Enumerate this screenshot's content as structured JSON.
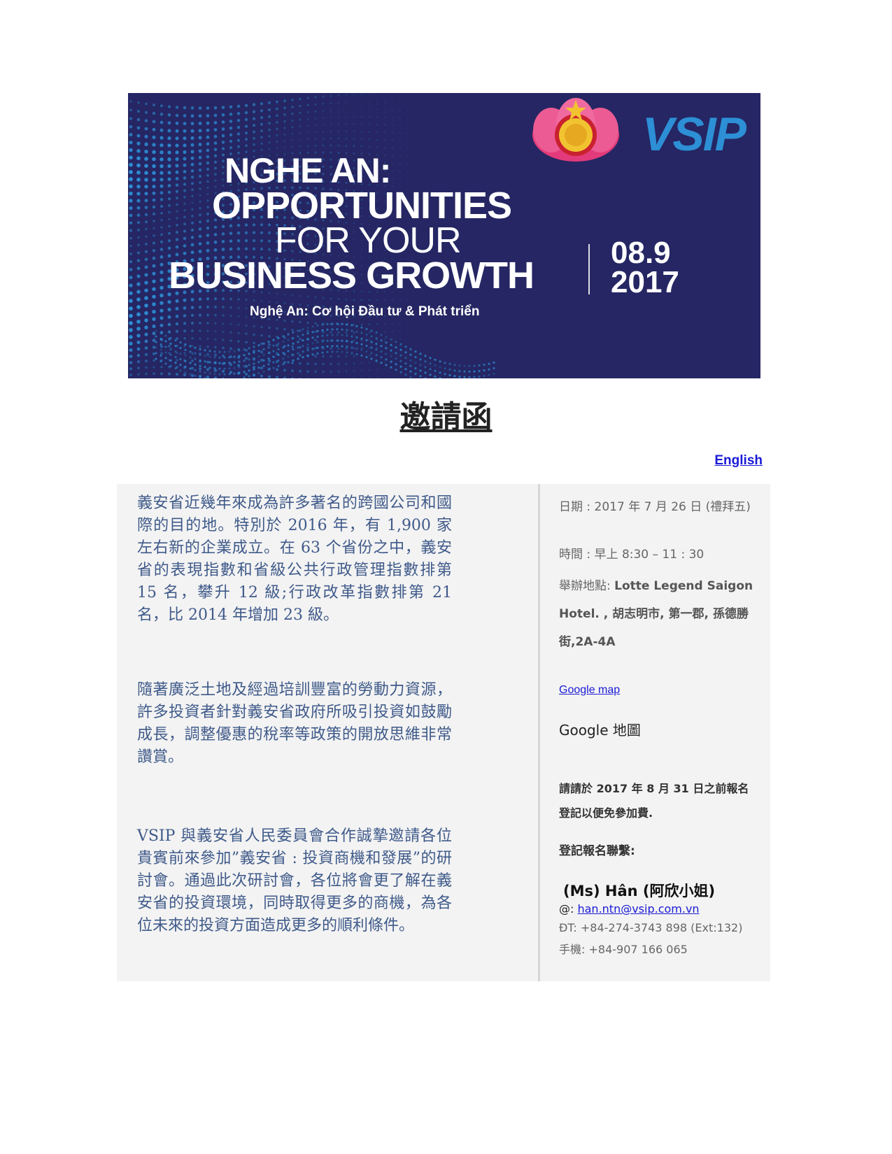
{
  "banner": {
    "title_line1": "NGHE AN:",
    "title_line2": "OPPORTUNITIES",
    "title_line3": "FOR YOUR",
    "title_line4": "BUSINESS GROWTH",
    "subtitle": "Nghệ An: Cơ hội Đầu tư & Phát triển",
    "date_line1": "08.9",
    "date_line2": "2017",
    "logo_text": "VSIP",
    "background_color": "#252663",
    "accent_color": "#2d8fd5"
  },
  "doc": {
    "title": "邀請函",
    "language_link": "English"
  },
  "left": {
    "para1": "義安省近幾年來成為許多著名的跨國公司和國際的目的地。特別於 2016 年，有 1,900 家左右新的企業成立。在 63 个省份之中，義安省的表現指數和省級公共行政管理指數排第 15 名，攀升 12 級;行政改革指數排第 21 名，比 2014 年增加 23 級。",
    "para2": "隨著廣泛土地及經過培訓豐富的勞動力資源，許多投資者針對義安省政府所吸引投資如鼓勵成長，調整優惠的稅率等政策的開放思維非常讚賞。",
    "para3": "VSIP 與義安省人民委員會合作誠摯邀請各位貴賓前來參加”義安省 : 投資商機和發展”的研討會。通過此次研討會，各位將會更了解在義安省的投資環境，同時取得更多的商機，為各位未來的投資方面造成更多的順利條件。"
  },
  "right": {
    "date": "日期 : 2017 年 7 月 26 日 (禮拜五)",
    "time": "時間 : 早上 8:30 – 11 : 30",
    "venue_label": "舉辦地點: ",
    "venue_value": "Lotte Legend Saigon Hotel. , 胡志明市, 第一郡, 孫德勝街,2A-4A",
    "google_map": "Google map",
    "google_map_zh": "Google 地圖",
    "register_note": "請請於 2017 年 8 月 31 日之前報名登記以便免參加費.",
    "contact_heading": "登記報名聯繫:",
    "contact_name": "(Ms) Hân (阿欣小姐)",
    "email_prefix": "@: ",
    "email": "han.ntn@vsip.com.vn",
    "phone": "ĐT: +84-274-3743 898 (Ext:132)",
    "mobile": "手機: +84-907 166 065"
  }
}
